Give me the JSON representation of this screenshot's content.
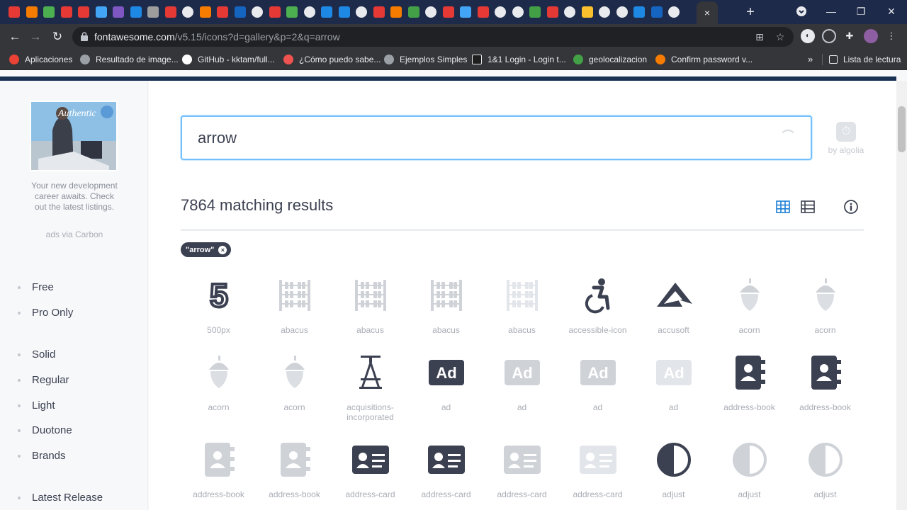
{
  "browser": {
    "url_domain": "fontawesome.com",
    "url_path": "/v5.15/icons?d=gallery&p=2&q=arrow",
    "active_tab_close": "×",
    "new_tab": "+",
    "controls": [
      "—",
      "❐",
      "×"
    ],
    "tab_favicons": [
      "#e53935",
      "#f57c00",
      "#4caf50",
      "#e53935",
      "#e53935",
      "#42a5f5",
      "#7e57c2",
      "#1e88e5",
      "#9e9e9e",
      "#e53935",
      "#ffffff",
      "#f57c00",
      "#e53935",
      "#1565c0",
      "#ffffff",
      "#e53935",
      "#4caf50",
      "#ffffff",
      "#1e88e5",
      "#1e88e5",
      "#ffffff",
      "#e53935",
      "#f57c00",
      "#43a047",
      "#ffffff",
      "#e53935",
      "#42a5f5",
      "#e53935",
      "#ffffff",
      "#ffffff",
      "#43a047",
      "#e53935",
      "#ffffff",
      "#fbc02d",
      "#ffffff",
      "#ffffff",
      "#1e88e5",
      "#1565c0",
      "#ffffff"
    ],
    "bookmarks": [
      {
        "label": "Aplicaciones",
        "color": "#ea4335"
      },
      {
        "label": "Resultado de image...",
        "color": "#9aa0a6"
      },
      {
        "label": "GitHub - kktam/full...",
        "color": "#ffffff"
      },
      {
        "label": "¿Cómo puedo sabe...",
        "color": "#ef5350"
      },
      {
        "label": "Ejemplos Simples",
        "color": "#9aa0a6"
      },
      {
        "label": "1&1 Login - Login t...",
        "color": "#1e1e1e"
      },
      {
        "label": "geolocalizacion",
        "color": "#43a047"
      },
      {
        "label": "Confirm password v...",
        "color": "#f57c00"
      }
    ],
    "reading_list": "Lista de lectura",
    "more": "»"
  },
  "sidebar": {
    "ad_text": "Your new development career awaits. Check out the latest listings.",
    "ad_via": "ads via Carbon",
    "license_filters": [
      "Free",
      "Pro Only"
    ],
    "style_filters": [
      "Solid",
      "Regular",
      "Light",
      "Duotone",
      "Brands"
    ],
    "latest": "Latest Release"
  },
  "search": {
    "value": "arrow",
    "algolia_label": "by algolia"
  },
  "results": {
    "count_text": "7864 matching results",
    "filter_pill": "\"arrow\"",
    "filter_remove": "×"
  },
  "icons": [
    {
      "name": "500px",
      "icon": "500px-icon",
      "tone": "dark"
    },
    {
      "name": "abacus",
      "icon": "abacus-icon",
      "tone": "light"
    },
    {
      "name": "abacus",
      "icon": "abacus-icon",
      "tone": "light"
    },
    {
      "name": "abacus",
      "icon": "abacus-icon",
      "tone": "light"
    },
    {
      "name": "abacus",
      "icon": "abacus-icon",
      "tone": "lighter"
    },
    {
      "name": "accessible-icon",
      "icon": "wheelchair-icon",
      "tone": "dark"
    },
    {
      "name": "accusoft",
      "icon": "accusoft-icon",
      "tone": "dark"
    },
    {
      "name": "acorn",
      "icon": "acorn-icon",
      "tone": "light"
    },
    {
      "name": "acorn",
      "icon": "acorn-icon",
      "tone": "light"
    },
    {
      "name": "acorn",
      "icon": "acorn-icon",
      "tone": "light"
    },
    {
      "name": "acorn",
      "icon": "acorn-icon",
      "tone": "light"
    },
    {
      "name": "acquisitions-incorporated",
      "icon": "acquisitions-incorporated-icon",
      "tone": "dark"
    },
    {
      "name": "ad",
      "icon": "ad-icon",
      "tone": "dark"
    },
    {
      "name": "ad",
      "icon": "ad-icon",
      "tone": "light"
    },
    {
      "name": "ad",
      "icon": "ad-icon",
      "tone": "light"
    },
    {
      "name": "ad",
      "icon": "ad-icon",
      "tone": "lighter"
    },
    {
      "name": "address-book",
      "icon": "address-book-icon",
      "tone": "dark"
    },
    {
      "name": "address-book",
      "icon": "address-book-icon",
      "tone": "dark"
    },
    {
      "name": "address-book",
      "icon": "address-book-icon",
      "tone": "light"
    },
    {
      "name": "address-book",
      "icon": "address-book-icon",
      "tone": "light"
    },
    {
      "name": "address-card",
      "icon": "address-card-icon",
      "tone": "dark"
    },
    {
      "name": "address-card",
      "icon": "address-card-icon",
      "tone": "dark"
    },
    {
      "name": "address-card",
      "icon": "address-card-icon",
      "tone": "light"
    },
    {
      "name": "address-card",
      "icon": "address-card-icon",
      "tone": "lighter"
    },
    {
      "name": "adjust",
      "icon": "adjust-icon",
      "tone": "dark"
    },
    {
      "name": "adjust",
      "icon": "adjust-icon",
      "tone": "light"
    },
    {
      "name": "adjust",
      "icon": "adjust-icon",
      "tone": "light"
    }
  ],
  "colors": {
    "dark": "#3c4152",
    "light": "#cfd3d8",
    "lighter": "#e2e5e9",
    "accent": "#1c7ed6",
    "navy": "#183153"
  }
}
